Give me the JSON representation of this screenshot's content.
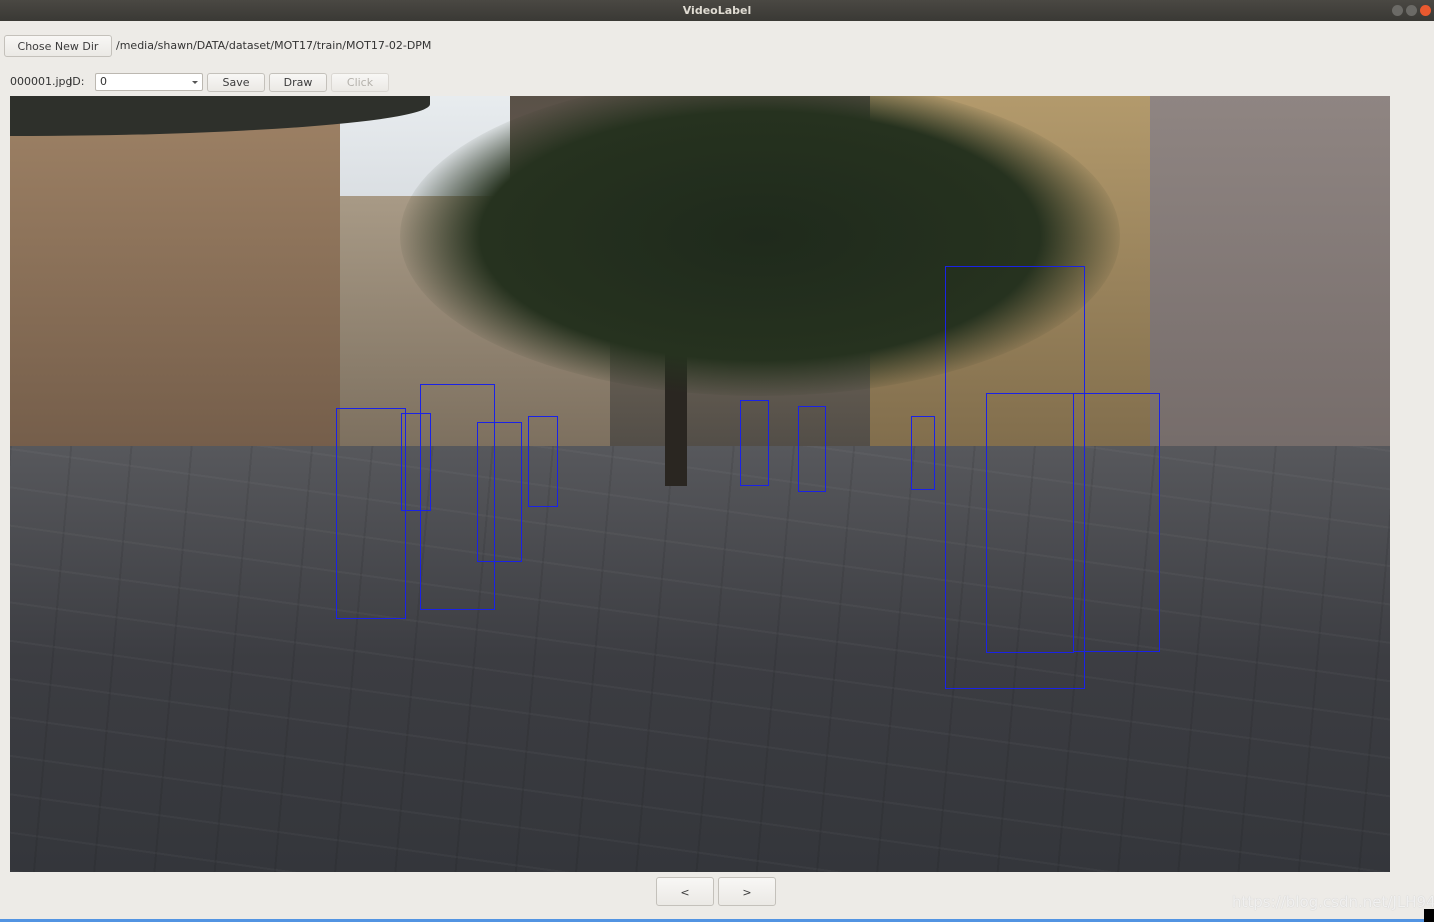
{
  "window": {
    "title": "VideoLabel"
  },
  "toolbar": {
    "chose_dir_label": "Chose New Dir",
    "dir_path": "/media/shawn/DATA/dataset/MOT17/train/MOT17-02-DPM",
    "filename": "000001.jpg",
    "id_label": "ID:",
    "id_value": "0",
    "save_label": "Save",
    "draw_label": "Draw",
    "click_label": "Click"
  },
  "frame": {
    "bbox_color": "#1a22e6",
    "bbox_count": 11
  },
  "navigation": {
    "prev_label": "<",
    "next_label": ">"
  },
  "watermark": "https://blog.csdn.net/JLH94",
  "colors": {
    "accent": "#5294e2",
    "close_button": "#e9592f"
  }
}
